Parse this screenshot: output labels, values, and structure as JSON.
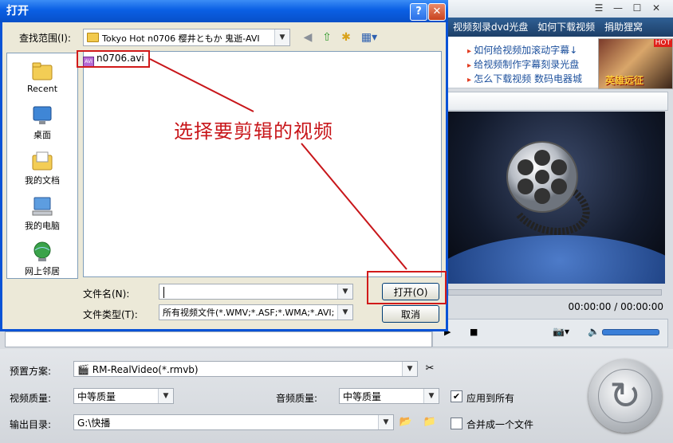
{
  "app": {
    "nav_items": [
      "视频刻录dvd光盘",
      "如何下载视频",
      "捐助狸窝"
    ],
    "ad_links": [
      "如何给视频加滚动字幕↓",
      "给视频制作字幕刻录光盘",
      "怎么下载视频  数码电器城"
    ],
    "ad_hot": "HOT",
    "ad_game_text": "英雄远征",
    "time_display": "00:00:00 / 00:00:00"
  },
  "dialog": {
    "title": "打开",
    "look_in_label": "查找范围(I):",
    "look_in_value": "Tokyo Hot n0706 樱井ともか 鬼逝-AVI",
    "places": [
      "Recent",
      "桌面",
      "我的文档",
      "我的电脑",
      "网上邻居"
    ],
    "files": [
      "n0706.avi"
    ],
    "annotation": "选择要剪辑的视频",
    "file_name_label": "文件名(N):",
    "file_name_value": "",
    "file_type_label": "文件类型(T):",
    "file_type_value": "所有视频文件(*.WMV;*.ASF;*.WMA;*.AVI;",
    "open_button": "打开(O)",
    "cancel_button": "取消"
  },
  "settings": {
    "preset_label": "预置方案:",
    "preset_value": "RM-RealVideo(*.rmvb)",
    "video_quality_label": "视频质量:",
    "video_quality_value": "中等质量",
    "audio_quality_label": "音频质量:",
    "audio_quality_value": "中等质量",
    "apply_all_label": "应用到所有",
    "apply_all_checked": true,
    "output_dir_label": "输出目录:",
    "output_dir_value": "G:\\快播",
    "merge_label": "合并成一个文件",
    "merge_checked": false
  },
  "colors": {
    "xp_title": "#0a5fe4",
    "annotation_red": "#c8161a",
    "nav_bg": "#2f5f94"
  }
}
